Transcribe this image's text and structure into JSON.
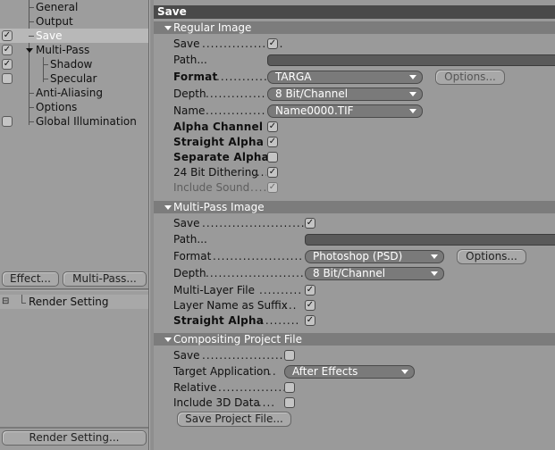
{
  "tree": {
    "items": [
      {
        "label": "General",
        "checked": null
      },
      {
        "label": "Output",
        "checked": null
      },
      {
        "label": "Save",
        "checked": true
      },
      {
        "label": "Multi-Pass",
        "checked": true
      },
      {
        "label": "Shadow",
        "checked": true
      },
      {
        "label": "Specular",
        "checked": false
      },
      {
        "label": "Anti-Aliasing",
        "checked": null
      },
      {
        "label": "Options",
        "checked": null
      },
      {
        "label": "Global Illumination",
        "checked": false
      }
    ],
    "selected": "Save"
  },
  "left_buttons": {
    "effect": "Effect...",
    "multipass": "Multi-Pass..."
  },
  "render_setting_item": "Render Setting",
  "render_setting_button": "Render Setting...",
  "panel_title": "Save",
  "regular_image": {
    "header": "Regular Image",
    "save_label": "Save",
    "path_label": "Path...",
    "format_label": "Format",
    "format_value": "TARGA",
    "options_button": "Options...",
    "depth_label": "Depth",
    "depth_value": "8 Bit/Channel",
    "name_label": "Name",
    "name_value": "Name0000.TIF",
    "alpha_channel_label": "Alpha Channel",
    "straight_alpha_label": "Straight Alpha",
    "separate_alpha_label": "Separate Alpha",
    "dithering_label": "24 Bit Dithering",
    "include_sound_label": "Include Sound"
  },
  "multipass_image": {
    "header": "Multi-Pass Image",
    "save_label": "Save",
    "path_label": "Path...",
    "format_label": "Format",
    "format_value": "Photoshop (PSD)",
    "options_button": "Options...",
    "depth_label": "Depth",
    "depth_value": "8 Bit/Channel",
    "multilayer_label": "Multi-Layer File",
    "layer_suffix_label": "Layer Name as Suffix",
    "straight_alpha_label": "Straight Alpha"
  },
  "compositing": {
    "header": "Compositing Project File",
    "save_label": "Save",
    "target_label": "Target Application",
    "target_value": "After Effects",
    "relative_label": "Relative",
    "include3d_label": "Include 3D Data",
    "save_project_button": "Save Project File..."
  },
  "glyphs": {
    "check": "✓",
    "collapse_toggle": "⊟"
  }
}
